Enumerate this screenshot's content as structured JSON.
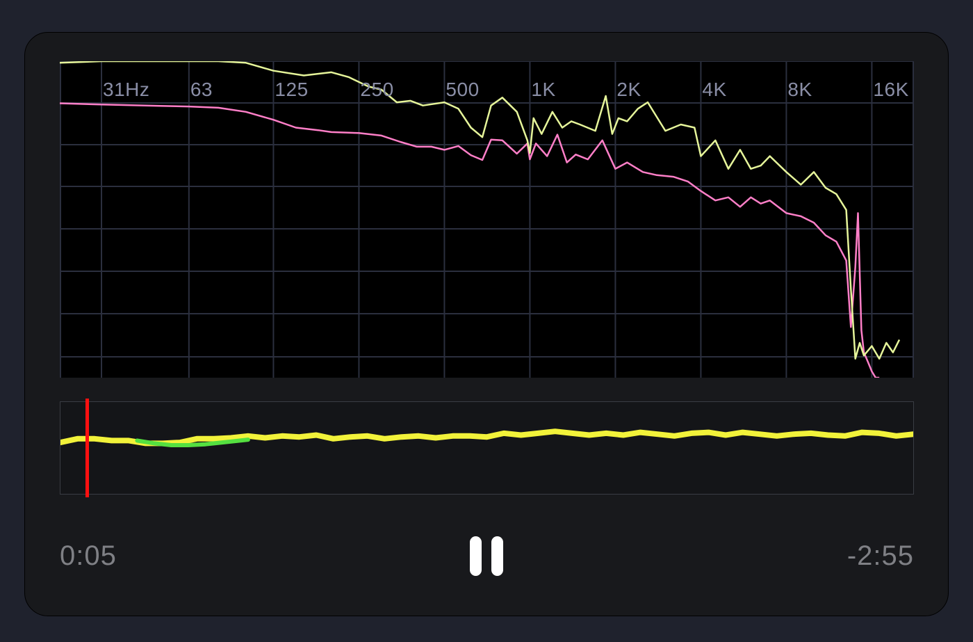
{
  "player": {
    "elapsed": "0:05",
    "remaining": "-2:55",
    "pause_label": "Pause",
    "playhead_fraction": 0.032
  },
  "colors": {
    "background": "#1f222d",
    "card": "#18191c",
    "grid": "#2b2f3e",
    "peak_series": "#e6f59a",
    "average_series": "#ff7fc8",
    "loudness_primary": "#f2f23a",
    "loudness_secondary": "#55e040",
    "playhead": "#ff1010"
  },
  "icons": {
    "pause": "pause-icon"
  },
  "chart_data": [
    {
      "type": "line",
      "xscale": "log",
      "ticks": [
        {
          "hz": 31,
          "label": "31Hz"
        },
        {
          "hz": 63,
          "label": "63"
        },
        {
          "hz": 125,
          "label": "125"
        },
        {
          "hz": 250,
          "label": "250"
        },
        {
          "hz": 500,
          "label": "500"
        },
        {
          "hz": 1000,
          "label": "1K"
        },
        {
          "hz": 2000,
          "label": "2K"
        },
        {
          "hz": 4000,
          "label": "4K"
        },
        {
          "hz": 8000,
          "label": "8K"
        },
        {
          "hz": 16000,
          "label": "16K"
        }
      ],
      "xlim": [
        20,
        20000
      ],
      "ylim": [
        0,
        1
      ],
      "grid": true,
      "series": [
        {
          "key": "peak",
          "color": "#e6f59a",
          "x": [
            20,
            31,
            50,
            63,
            80,
            100,
            125,
            160,
            200,
            230,
            270,
            300,
            340,
            380,
            420,
            500,
            560,
            620,
            680,
            730,
            800,
            900,
            980,
            1000,
            1030,
            1100,
            1200,
            1300,
            1400,
            1500,
            1700,
            1850,
            1950,
            2050,
            2200,
            2400,
            2600,
            3000,
            3400,
            3800,
            4000,
            4500,
            5000,
            5500,
            6000,
            6500,
            7000,
            8000,
            9000,
            10000,
            11000,
            12000,
            13000,
            13500,
            14000,
            14500,
            15000,
            16000,
            17000,
            18000,
            19000,
            20000
          ],
          "y": [
            0.995,
            1.0,
            1.0,
            1.0,
            1.0,
            0.995,
            0.97,
            0.955,
            0.965,
            0.95,
            0.92,
            0.91,
            0.87,
            0.875,
            0.86,
            0.87,
            0.85,
            0.79,
            0.76,
            0.86,
            0.885,
            0.84,
            0.75,
            0.71,
            0.82,
            0.77,
            0.84,
            0.79,
            0.81,
            0.8,
            0.78,
            0.89,
            0.77,
            0.82,
            0.81,
            0.85,
            0.87,
            0.78,
            0.8,
            0.79,
            0.7,
            0.75,
            0.66,
            0.72,
            0.66,
            0.67,
            0.7,
            0.65,
            0.61,
            0.65,
            0.6,
            0.58,
            0.53,
            0.28,
            0.06,
            0.11,
            0.07,
            0.1,
            0.06,
            0.11,
            0.08,
            0.12
          ]
        },
        {
          "key": "average",
          "color": "#ff7fc8",
          "x": [
            20,
            31,
            50,
            63,
            80,
            100,
            125,
            150,
            180,
            200,
            250,
            300,
            350,
            400,
            450,
            500,
            560,
            620,
            680,
            730,
            800,
            900,
            980,
            1000,
            1050,
            1150,
            1250,
            1350,
            1450,
            1600,
            1800,
            2000,
            2200,
            2500,
            2800,
            3200,
            3600,
            4000,
            4500,
            5000,
            5500,
            6000,
            6500,
            7000,
            8000,
            9000,
            10000,
            11000,
            12000,
            13000,
            13500,
            14000,
            14300,
            14700,
            15000,
            15500,
            16000,
            16500,
            17000
          ],
          "y": [
            0.867,
            0.863,
            0.859,
            0.857,
            0.853,
            0.84,
            0.815,
            0.79,
            0.782,
            0.776,
            0.773,
            0.765,
            0.745,
            0.73,
            0.73,
            0.72,
            0.732,
            0.703,
            0.688,
            0.752,
            0.75,
            0.708,
            0.74,
            0.69,
            0.74,
            0.7,
            0.768,
            0.68,
            0.705,
            0.69,
            0.75,
            0.66,
            0.68,
            0.65,
            0.64,
            0.635,
            0.62,
            0.59,
            0.56,
            0.57,
            0.54,
            0.57,
            0.55,
            0.56,
            0.52,
            0.51,
            0.49,
            0.45,
            0.43,
            0.37,
            0.16,
            0.35,
            0.52,
            0.15,
            0.08,
            0.05,
            0.02,
            0.0,
            0.0
          ]
        }
      ]
    },
    {
      "type": "line",
      "xlim": [
        0,
        1
      ],
      "ylim": [
        0,
        1
      ],
      "series": [
        {
          "key": "loudness",
          "color": "#f2f23a",
          "x": [
            0.0,
            0.02,
            0.04,
            0.06,
            0.08,
            0.1,
            0.12,
            0.14,
            0.16,
            0.18,
            0.2,
            0.22,
            0.24,
            0.26,
            0.28,
            0.3,
            0.32,
            0.34,
            0.36,
            0.38,
            0.4,
            0.42,
            0.44,
            0.46,
            0.48,
            0.5,
            0.52,
            0.54,
            0.56,
            0.58,
            0.6,
            0.62,
            0.64,
            0.66,
            0.68,
            0.7,
            0.72,
            0.74,
            0.76,
            0.78,
            0.8,
            0.82,
            0.84,
            0.86,
            0.88,
            0.9,
            0.92,
            0.94,
            0.96,
            0.98,
            1.0
          ],
          "y": [
            0.56,
            0.6,
            0.6,
            0.58,
            0.58,
            0.55,
            0.55,
            0.56,
            0.6,
            0.6,
            0.61,
            0.63,
            0.61,
            0.63,
            0.62,
            0.64,
            0.6,
            0.62,
            0.63,
            0.6,
            0.62,
            0.63,
            0.61,
            0.63,
            0.63,
            0.62,
            0.66,
            0.64,
            0.66,
            0.68,
            0.66,
            0.64,
            0.66,
            0.64,
            0.67,
            0.65,
            0.63,
            0.66,
            0.67,
            0.64,
            0.67,
            0.65,
            0.63,
            0.65,
            0.66,
            0.64,
            0.63,
            0.67,
            0.66,
            0.63,
            0.65
          ]
        },
        {
          "key": "loudness-secondary",
          "color": "#55e040",
          "x": [
            0.09,
            0.11,
            0.13,
            0.15,
            0.17,
            0.18,
            0.2,
            0.22
          ],
          "y": [
            0.58,
            0.55,
            0.53,
            0.53,
            0.54,
            0.55,
            0.57,
            0.59
          ]
        }
      ]
    }
  ]
}
